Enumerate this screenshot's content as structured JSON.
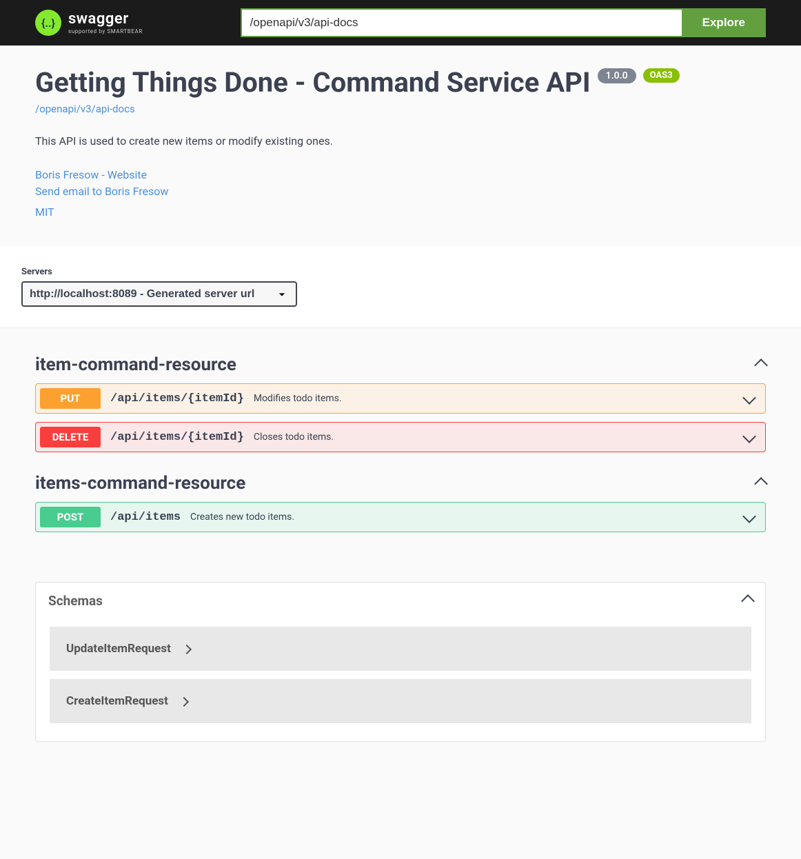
{
  "topbar": {
    "logo_main": "swagger",
    "logo_sub": "supported by SMARTBEAR",
    "url_value": "/openapi/v3/api-docs",
    "explore_label": "Explore"
  },
  "info": {
    "title": "Getting Things Done - Command Service API",
    "version": "1.0.0",
    "oas": "OAS3",
    "docs_link": "/openapi/v3/api-docs",
    "description": "This API is used to create new items or modify existing ones.",
    "contact_website": "Boris Fresow - Website",
    "contact_email": "Send email to Boris Fresow",
    "license": "MIT"
  },
  "servers": {
    "label": "Servers",
    "selected": "http://localhost:8089 - Generated server url"
  },
  "tags": [
    {
      "name": "item-command-resource",
      "ops": [
        {
          "method": "PUT",
          "method_class": "put",
          "path": "/api/items/{itemId}",
          "summary": "Modifies todo items."
        },
        {
          "method": "DELETE",
          "method_class": "delete",
          "path": "/api/items/{itemId}",
          "summary": "Closes todo items."
        }
      ]
    },
    {
      "name": "items-command-resource",
      "ops": [
        {
          "method": "POST",
          "method_class": "post",
          "path": "/api/items",
          "summary": "Creates new todo items."
        }
      ]
    }
  ],
  "schemas": {
    "title": "Schemas",
    "items": [
      "UpdateItemRequest",
      "CreateItemRequest"
    ]
  }
}
